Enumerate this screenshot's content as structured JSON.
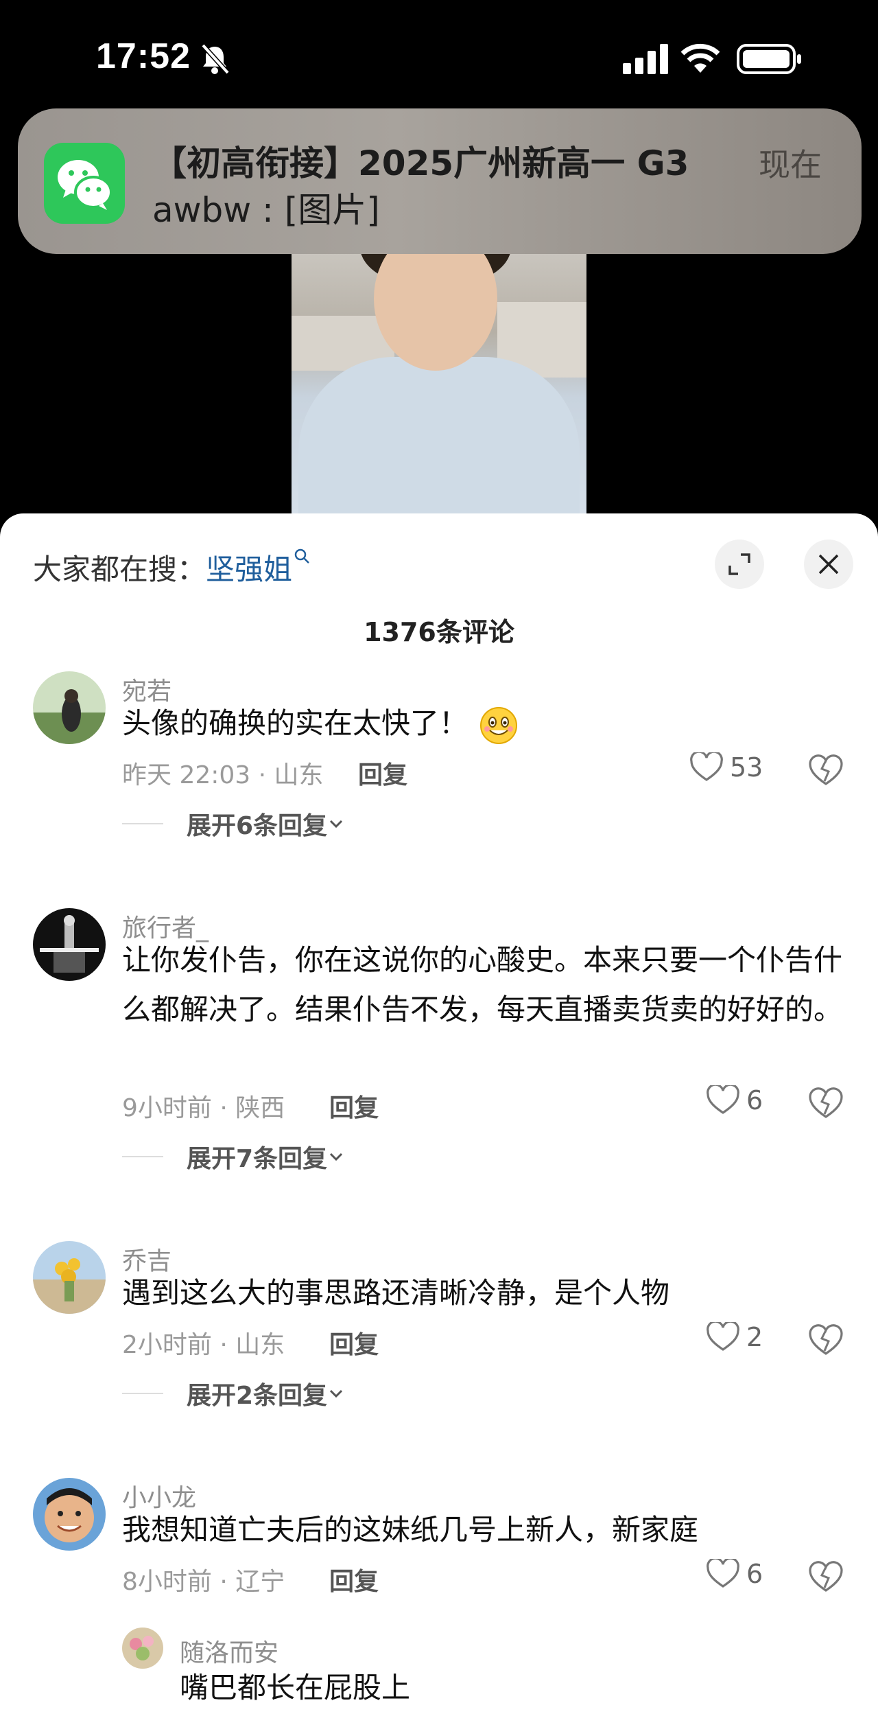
{
  "status_bar": {
    "time": "17:52"
  },
  "notification": {
    "title": "【初高衔接】2025广州新高一 G3",
    "body": "awbw : [图片]",
    "time": "现在",
    "app_icon": "wechat-icon"
  },
  "search_hint": {
    "prefix": "大家都在搜：",
    "term": "坚强姐"
  },
  "comment_count": "1376条评论",
  "comments": [
    {
      "user": "宛若",
      "text": "头像的确换的实在太快了！",
      "emoji": "grinning-face",
      "meta": "昨天 22:03 · 山东",
      "reply_label": "回复",
      "likes": "53",
      "expand": "展开6条回复"
    },
    {
      "user": "旅行者_",
      "text": "让你发仆告，你在这说你的心酸史。本来只要一个仆告什么都解决了。结果仆告不发，每天直播卖货卖的好好的。",
      "meta": "9小时前 · 陕西",
      "reply_label": "回复",
      "likes": "6",
      "expand": "展开7条回复"
    },
    {
      "user": "乔吉",
      "text": "遇到这么大的事思路还清晰冷静，是个人物",
      "meta": "2小时前 · 山东",
      "reply_label": "回复",
      "likes": "2",
      "expand": "展开2条回复"
    },
    {
      "user": "小小龙",
      "text": "我想知道亡夫后的这妹纸几号上新人，新家庭",
      "meta": "8小时前 · 辽宁",
      "reply_label": "回复",
      "likes": "6"
    }
  ],
  "sub_reply": {
    "user": "随洛而安",
    "text": "嘴巴都长在屁股上"
  },
  "colors": {
    "accent_link": "#1f5e9c",
    "wechat_green": "#2ec75a"
  }
}
